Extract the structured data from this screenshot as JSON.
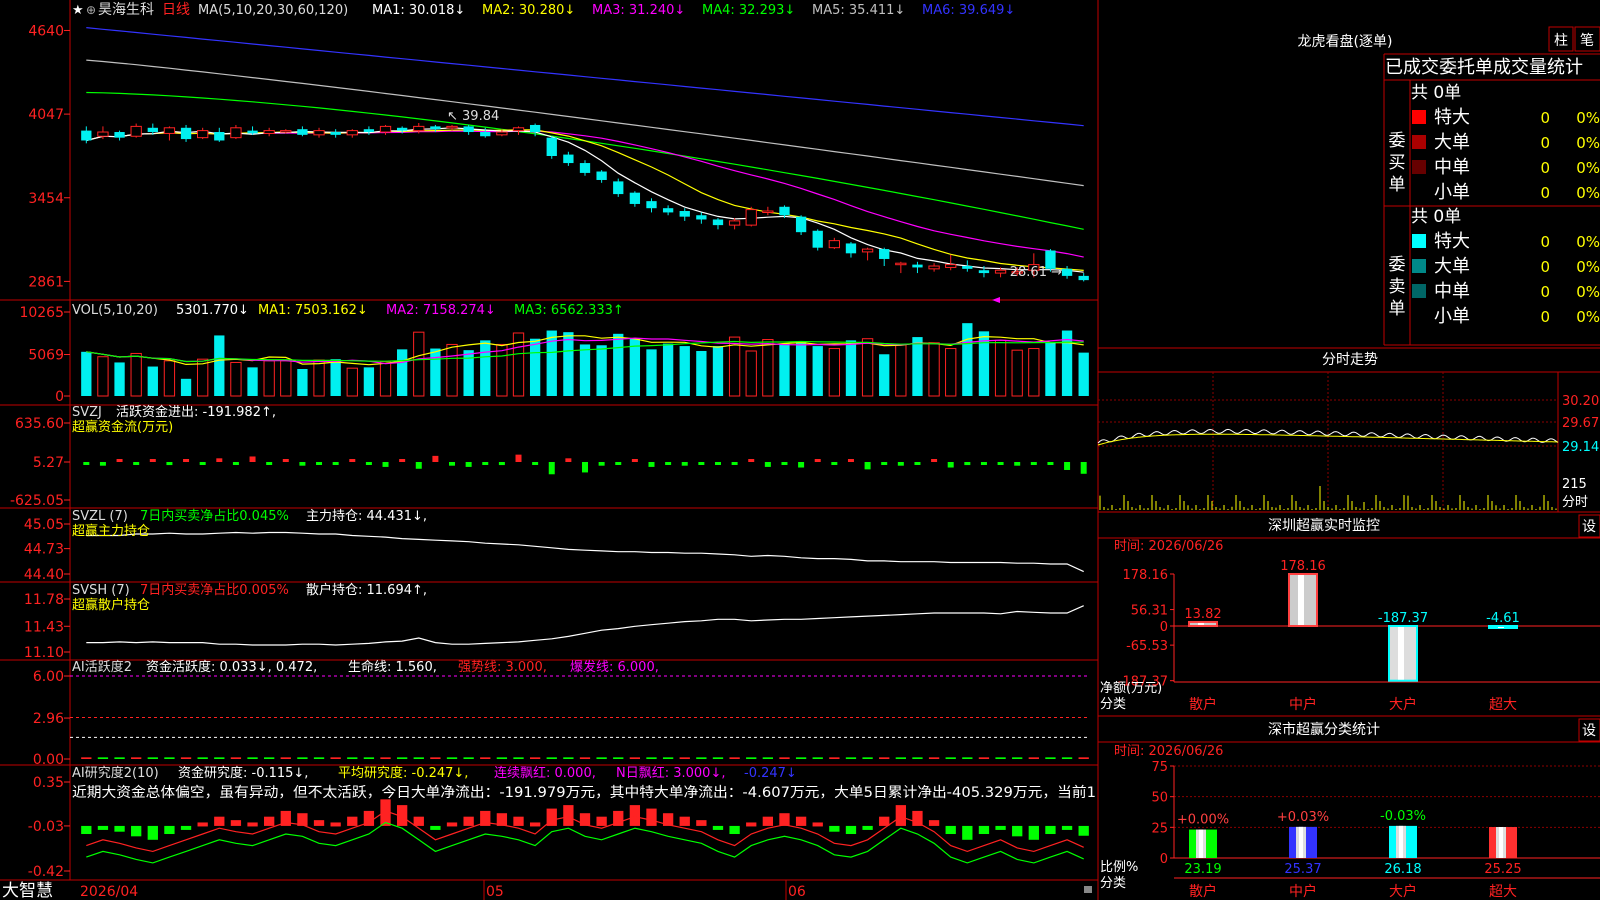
{
  "app": {
    "brand": "大智慧",
    "stock_name": "昊海生科",
    "period": "日线",
    "star": "★"
  },
  "colors": {
    "up": "#ff2222",
    "down": "#00f0f0",
    "ma1": "#ffffff",
    "ma2": "#ffff00",
    "ma3": "#ff00ff",
    "ma4": "#00ff00",
    "ma5": "#c0c0c0",
    "ma6": "#3333ff",
    "grid": "#8b0000",
    "frame": "#c00000",
    "green": "#00ff00",
    "yellow": "#ffff00",
    "magenta": "#ff00ff",
    "white": "#ffffff",
    "cyan": "#00ffff"
  },
  "price_panel": {
    "ma_header": "MA(5,10,20,30,60,120)",
    "ma_items": [
      {
        "label": "MA1: 30.018↓",
        "color": "#ffffff"
      },
      {
        "label": "MA2: 30.280↓",
        "color": "#ffff00"
      },
      {
        "label": "MA3: 31.240↓",
        "color": "#ff00ff"
      },
      {
        "label": "MA4: 32.293↓",
        "color": "#00ff00"
      },
      {
        "label": "MA5: 35.411↓",
        "color": "#c0c0c0"
      },
      {
        "label": "MA6: 39.649↓",
        "color": "#3333ff"
      }
    ],
    "y_ticks": [
      "4640",
      "4047",
      "3454",
      "2861"
    ],
    "annotation_high": "39.84",
    "annotation_low": "28.61"
  },
  "vol_panel": {
    "title": "VOL(5,10,20)",
    "value": "5301.770↓",
    "items": [
      {
        "label": "MA1: 7503.162↓",
        "color": "#ffff00"
      },
      {
        "label": "MA2: 7158.274↓",
        "color": "#ff00ff"
      },
      {
        "label": "MA3: 6562.333↑",
        "color": "#00ff00"
      }
    ],
    "y_ticks": [
      "10265",
      "5069",
      "0"
    ]
  },
  "svzj_panel": {
    "title": "SVZJ",
    "text": "活跃资金进出: -191.982↑,",
    "sub": "超赢资金流(万元)",
    "y_ticks": [
      "635.60",
      "5.27",
      "-625.05"
    ]
  },
  "svzl_panel": {
    "title": "SVZL (7)",
    "text1": "7日内买卖净占比0.045%",
    "text2": "主力持仓: 44.431↓,",
    "sub": "超赢主力持仓",
    "y_ticks": [
      "45.05",
      "44.73",
      "44.40"
    ]
  },
  "svsh_panel": {
    "title": "SVSH (7)",
    "text1": "7日内买卖净占比0.005%",
    "text2": "散户持仓: 11.694↑,",
    "sub": "超赢散户持仓",
    "y_ticks": [
      "11.78",
      "11.43",
      "11.10"
    ]
  },
  "ai_active_panel": {
    "title": "AI活跃度2",
    "text1": "资金活跃度: 0.033↓, 0.472,",
    "text2": "生命线: 1.560,",
    "text3": "强势线: 3.000,",
    "text4": "爆发线: 6.000,",
    "y_ticks": [
      "6.00",
      "2.96",
      "0.00"
    ]
  },
  "ai_research_panel": {
    "title": "AI研究度2(10)",
    "text1": "资金研究度: -0.115↓,",
    "text2": "平均研究度: -0.247↓,",
    "text3": "连续飘红: 0.000,",
    "text4": "N日飘红: 3.000↓,",
    "text5": "-0.247↓",
    "narrative": "近期大资金总体偏空，虽有异动，但不太活跃，今日大单净流出：-191.979万元，其中特大单净流出：-4.607万元，大单5日累计净出-405.329万元，当前1",
    "y_ticks": [
      "0.35",
      "-0.03",
      "-0.42"
    ]
  },
  "x_axis": {
    "labels": [
      "2026/04",
      "05",
      "06"
    ]
  },
  "longhu": {
    "title": "龙虎看盘(逐单)",
    "btn_zhu": "柱",
    "btn_bi": "笔",
    "header": "已成交委托单成交量统计",
    "buy": {
      "side": "委买单",
      "total": "共 0单",
      "rows": [
        {
          "name": "特大",
          "qty": "0",
          "pct": "0%",
          "color": "#ff0000"
        },
        {
          "name": "大单",
          "qty": "0",
          "pct": "0%",
          "color": "#aa0000"
        },
        {
          "name": "中单",
          "qty": "0",
          "pct": "0%",
          "color": "#660000"
        },
        {
          "name": "小单",
          "qty": "0",
          "pct": "0%",
          "color": "#000000"
        }
      ]
    },
    "sell": {
      "side": "委卖单",
      "total": "共 0单",
      "rows": [
        {
          "name": "特大",
          "qty": "0",
          "pct": "0%",
          "color": "#00ffff"
        },
        {
          "name": "大单",
          "qty": "0",
          "pct": "0%",
          "color": "#008888"
        },
        {
          "name": "中单",
          "qty": "0",
          "pct": "0%",
          "color": "#006666"
        },
        {
          "name": "小单",
          "qty": "0",
          "pct": "0%",
          "color": "#000000"
        }
      ]
    }
  },
  "intraday": {
    "title": "分时走势",
    "y_ticks": [
      "30.20",
      "29.67",
      "29.14"
    ],
    "vol_tick": "215",
    "vol_label": "分时"
  },
  "sz_monitor": {
    "title": "深圳超赢实时监控",
    "btn": "设",
    "time": "时间: 2026/06/26",
    "y_ticks": [
      "178.16",
      "56.31",
      "0",
      "-65.53",
      "-187.37"
    ],
    "net_label": "净额(万元)",
    "cat_label": "分类",
    "bars": [
      {
        "cat": "散户",
        "value": 13.82,
        "label": "13.82",
        "color": "#ff4040"
      },
      {
        "cat": "中户",
        "value": 178.16,
        "label": "178.16",
        "color": "#ff4040"
      },
      {
        "cat": "大户",
        "value": -187.37,
        "label": "-187.37",
        "color": "#00ffff"
      },
      {
        "cat": "超大",
        "value": -4.61,
        "label": "-4.61",
        "color": "#00ffff"
      }
    ]
  },
  "sz_class": {
    "title": "深市超赢分类统计",
    "btn": "设",
    "time": "时间: 2026/06/26",
    "y_ticks": [
      "75",
      "50",
      "25",
      "0"
    ],
    "ratio_label": "比例%",
    "cat_label": "分类",
    "bars": [
      {
        "cat": "散户",
        "pct": "+0.00%",
        "value": 23.19,
        "label": "23.19",
        "color": "#00ff00",
        "pct_color": "#ff4040"
      },
      {
        "cat": "中户",
        "pct": "+0.03%",
        "value": 25.37,
        "label": "25.37",
        "color": "#3333ff",
        "pct_color": "#ff4040"
      },
      {
        "cat": "大户",
        "pct": "-0.03%",
        "value": 26.18,
        "label": "26.18",
        "color": "#00ffff",
        "pct_color": "#00ff00"
      },
      {
        "cat": "超大",
        "pct": "",
        "value": 25.25,
        "label": "25.25",
        "color": "#ff3030",
        "pct_color": "#ff4040"
      }
    ]
  },
  "chart_data": {
    "type": "candlestick",
    "price_range": [
      28.0,
      47.0
    ],
    "candles": [
      [
        39.3,
        38.6,
        39.6,
        38.4
      ],
      [
        38.9,
        39.2,
        39.6,
        38.7
      ],
      [
        39.2,
        38.8,
        39.3,
        38.6
      ],
      [
        38.9,
        39.6,
        39.8,
        38.8
      ],
      [
        39.5,
        39.2,
        39.8,
        39.0
      ],
      [
        39.1,
        39.5,
        39.6,
        38.6
      ],
      [
        39.5,
        38.7,
        39.7,
        38.5
      ],
      [
        38.8,
        39.3,
        39.5,
        38.7
      ],
      [
        39.2,
        38.6,
        39.5,
        38.5
      ],
      [
        38.8,
        39.5,
        39.7,
        38.7
      ],
      [
        39.3,
        39.1,
        39.6,
        39.0
      ],
      [
        39.1,
        39.3,
        39.5,
        38.9
      ],
      [
        39.3,
        39.3,
        39.4,
        39.1
      ],
      [
        39.4,
        39.0,
        39.6,
        38.9
      ],
      [
        39.0,
        39.3,
        39.5,
        38.8
      ],
      [
        39.2,
        39.0,
        39.4,
        38.8
      ],
      [
        39.0,
        39.3,
        39.4,
        38.8
      ],
      [
        39.4,
        39.2,
        39.6,
        39.0
      ],
      [
        39.2,
        39.6,
        39.7,
        39.0
      ],
      [
        39.5,
        39.3,
        39.6,
        39.1
      ],
      [
        39.3,
        39.6,
        39.84,
        39.1
      ],
      [
        39.6,
        39.4,
        39.7,
        39.2
      ],
      [
        39.5,
        39.6,
        39.7,
        39.3
      ],
      [
        39.6,
        39.2,
        39.7,
        39.0
      ],
      [
        39.2,
        38.9,
        39.5,
        38.8
      ],
      [
        39.0,
        39.2,
        39.4,
        38.9
      ],
      [
        39.3,
        39.5,
        39.6,
        39.0
      ],
      [
        39.7,
        39.2,
        39.8,
        38.9
      ],
      [
        38.8,
        37.5,
        38.9,
        37.3
      ],
      [
        37.6,
        37.0,
        37.8,
        36.8
      ],
      [
        37.0,
        36.3,
        37.2,
        36.1
      ],
      [
        36.4,
        35.8,
        36.5,
        35.6
      ],
      [
        35.7,
        34.8,
        35.9,
        34.6
      ],
      [
        34.9,
        34.1,
        35.0,
        33.9
      ],
      [
        34.3,
        33.8,
        34.5,
        33.5
      ],
      [
        33.8,
        33.5,
        34.0,
        33.3
      ],
      [
        33.6,
        33.2,
        33.8,
        32.9
      ],
      [
        33.3,
        33.0,
        33.5,
        32.7
      ],
      [
        33.0,
        32.6,
        33.1,
        32.3
      ],
      [
        32.6,
        32.9,
        33.1,
        32.3
      ],
      [
        32.6,
        33.7,
        33.9,
        32.5
      ],
      [
        33.6,
        33.6,
        33.9,
        33.3
      ],
      [
        33.9,
        33.3,
        34.0,
        33.1
      ],
      [
        33.2,
        32.1,
        33.3,
        31.9
      ],
      [
        32.2,
        31.0,
        32.3,
        30.8
      ],
      [
        31.0,
        31.5,
        31.7,
        30.9
      ],
      [
        31.3,
        30.6,
        31.4,
        30.3
      ],
      [
        30.7,
        30.9,
        31.0,
        30.1
      ],
      [
        30.9,
        30.2,
        31.0,
        29.7
      ],
      [
        29.8,
        29.9,
        30.0,
        29.2
      ],
      [
        29.8,
        29.6,
        30.0,
        29.2
      ],
      [
        29.5,
        29.7,
        29.9,
        29.3
      ],
      [
        29.6,
        29.8,
        30.5,
        29.4
      ],
      [
        29.7,
        29.5,
        30.1,
        29.3
      ],
      [
        29.4,
        29.2,
        29.7,
        28.9
      ],
      [
        29.2,
        29.4,
        29.6,
        28.9
      ],
      [
        29.3,
        29.3,
        29.6,
        29.0
      ],
      [
        29.4,
        29.8,
        30.6,
        28.9
      ],
      [
        30.8,
        29.5,
        30.9,
        29.3
      ],
      [
        29.5,
        29.0,
        29.7,
        28.8
      ],
      [
        29.0,
        28.7,
        29.2,
        28.61
      ]
    ],
    "volume": [
      5400,
      4800,
      4100,
      5200,
      3600,
      4300,
      2100,
      4500,
      7400,
      4100,
      3500,
      4300,
      4300,
      3300,
      4400,
      4500,
      3400,
      3500,
      4200,
      5700,
      7800,
      5800,
      6300,
      5600,
      6800,
      6300,
      7700,
      7000,
      8000,
      7800,
      6300,
      6200,
      7600,
      7000,
      5700,
      6400,
      6100,
      5500,
      6100,
      7200,
      5500,
      6900,
      6400,
      6700,
      6100,
      5800,
      6800,
      7000,
      5100,
      6300,
      7200,
      6500,
      5800,
      8900,
      7900,
      6800,
      5600,
      5800,
      6500,
      8000,
      5300
    ],
    "svzj": [
      -40,
      -60,
      20,
      -30,
      10,
      -50,
      30,
      -20,
      60,
      -30,
      90,
      -40,
      40,
      -60,
      -20,
      -30,
      20,
      -10,
      -80,
      30,
      -110,
      100,
      -60,
      -80,
      -40,
      -50,
      120,
      -30,
      -200,
      60,
      -170,
      -60,
      -40,
      10,
      -80,
      -20,
      -60,
      -40,
      -30,
      -40,
      20,
      -80,
      -30,
      -90,
      30,
      -40,
      40,
      -120,
      -30,
      -60,
      -20,
      30,
      -90,
      -50,
      -40,
      -30,
      -60,
      -40,
      -30,
      -130,
      -191.98
    ],
    "svzl": [
      44.9,
      44.9,
      44.9,
      44.92,
      44.92,
      44.93,
      44.92,
      44.92,
      44.93,
      44.94,
      44.93,
      44.94,
      44.94,
      44.93,
      44.92,
      44.92,
      44.9,
      44.89,
      44.88,
      44.86,
      44.85,
      44.84,
      44.83,
      44.82,
      44.8,
      44.79,
      44.78,
      44.76,
      44.74,
      44.72,
      44.71,
      44.7,
      44.69,
      44.69,
      44.68,
      44.68,
      44.67,
      44.67,
      44.66,
      44.65,
      44.63,
      44.64,
      44.63,
      44.61,
      44.6,
      44.6,
      44.59,
      44.57,
      44.57,
      44.56,
      44.56,
      44.56,
      44.55,
      44.55,
      44.55,
      44.55,
      44.54,
      44.54,
      44.53,
      44.53,
      44.431
    ],
    "svsh": [
      11.22,
      11.22,
      11.23,
      11.22,
      11.23,
      11.22,
      11.22,
      11.22,
      11.2,
      11.2,
      11.19,
      11.19,
      11.19,
      11.2,
      11.2,
      11.19,
      11.2,
      11.21,
      11.23,
      11.24,
      11.28,
      11.22,
      11.2,
      11.2,
      11.21,
      11.22,
      11.23,
      11.25,
      11.27,
      11.3,
      11.34,
      11.38,
      11.4,
      11.43,
      11.45,
      11.47,
      11.49,
      11.5,
      11.52,
      11.52,
      11.5,
      11.51,
      11.52,
      11.52,
      11.53,
      11.54,
      11.55,
      11.56,
      11.57,
      11.58,
      11.59,
      11.6,
      11.6,
      11.6,
      11.6,
      11.59,
      11.62,
      11.61,
      11.6,
      11.6,
      11.694
    ],
    "ai_research": [
      -0.1,
      -0.05,
      -0.08,
      -0.12,
      -0.15,
      -0.1,
      -0.05,
      0.0,
      0.05,
      0.02,
      0.0,
      0.05,
      0.1,
      0.08,
      0.02,
      0.0,
      0.05,
      0.1,
      0.2,
      0.15,
      0.05,
      -0.05,
      0.0,
      0.05,
      0.1,
      0.08,
      0.05,
      0.0,
      0.12,
      0.15,
      0.08,
      0.05,
      0.1,
      0.15,
      0.12,
      0.08,
      0.05,
      0.02,
      -0.05,
      -0.1,
      0.0,
      0.05,
      0.08,
      0.05,
      0.0,
      -0.08,
      -0.1,
      -0.05,
      0.05,
      0.15,
      0.1,
      0.02,
      -0.1,
      -0.15,
      -0.1,
      -0.05,
      -0.12,
      -0.15,
      -0.1,
      -0.05,
      -0.115
    ]
  }
}
